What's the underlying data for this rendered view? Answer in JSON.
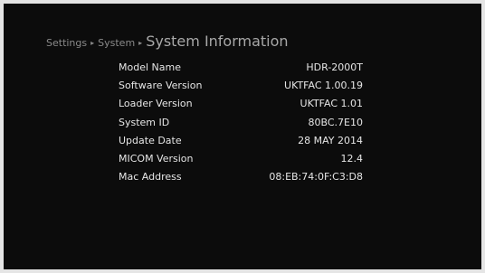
{
  "breadcrumb": {
    "items": [
      "Settings",
      "System"
    ],
    "current": "System Information",
    "separator": "▸"
  },
  "info": {
    "rows": [
      {
        "label": "Model Name",
        "value": "HDR-2000T"
      },
      {
        "label": "Software Version",
        "value": "UKTFAC 1.00.19"
      },
      {
        "label": "Loader Version",
        "value": "UKTFAC 1.01"
      },
      {
        "label": "System ID",
        "value": "80BC.7E10"
      },
      {
        "label": "Update Date",
        "value": "28 MAY 2014"
      },
      {
        "label": "MICOM Version",
        "value": "12.4"
      },
      {
        "label": "Mac Address",
        "value": "08:EB:74:0F:C3:D8"
      }
    ]
  },
  "colors": {
    "background": "#0c0c0c",
    "frame": "#e5e5e5",
    "text": "#e6e6e6",
    "breadcrumb": "#8a8a8a"
  }
}
